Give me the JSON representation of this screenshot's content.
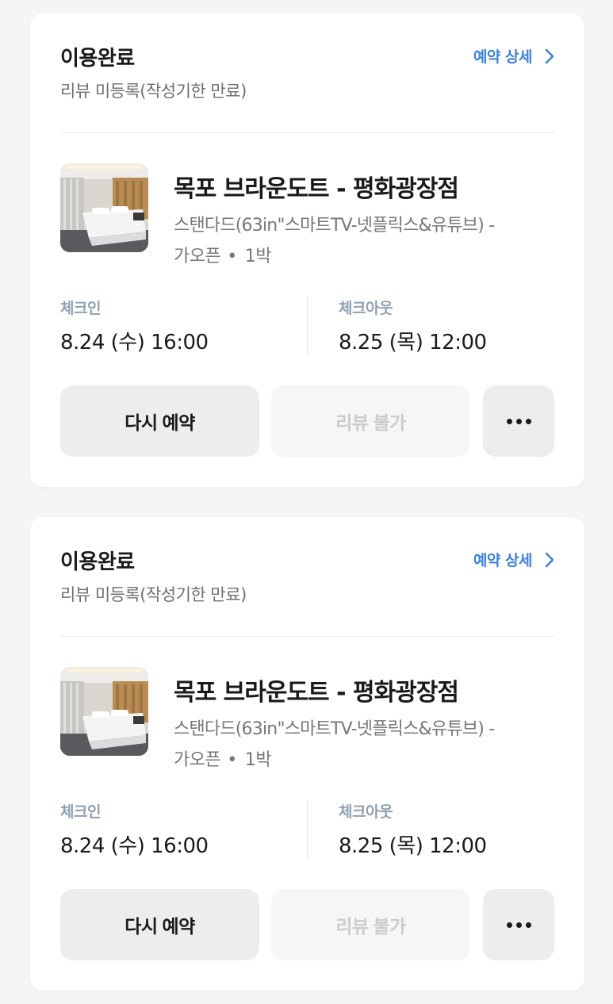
{
  "reservations": [
    {
      "status": "이용완료",
      "review_status": "리뷰 미등록(작성기한 만료)",
      "detail_label": "예약 상세",
      "hotel_name": "목포 브라운도트 - 평화광장점",
      "room_line1": "스탠다드(63in\"스마트TV-넷플릭스&유튜브) -",
      "room_line2": "가오픈",
      "nights": "1박",
      "checkin_label": "체크인",
      "checkin_value": "8.24 (수) 16:00",
      "checkout_label": "체크아웃",
      "checkout_value": "8.25 (목) 12:00",
      "rebook_label": "다시 예약",
      "review_label": "리뷰 불가"
    },
    {
      "status": "이용완료",
      "review_status": "리뷰 미등록(작성기한 만료)",
      "detail_label": "예약 상세",
      "hotel_name": "목포 브라운도트 - 평화광장점",
      "room_line1": "스탠다드(63in\"스마트TV-넷플릭스&유튜브) -",
      "room_line2": "가오픈",
      "nights": "1박",
      "checkin_label": "체크인",
      "checkin_value": "8.24 (수) 16:00",
      "checkout_label": "체크아웃",
      "checkout_value": "8.25 (목) 12:00",
      "rebook_label": "다시 예약",
      "review_label": "리뷰 불가"
    }
  ],
  "icons": {
    "detail_chevron": "chevron-right-icon",
    "more": "more-dots-icon",
    "thumbnail": "hotel-room-photo"
  },
  "colors": {
    "accent": "#3b82d6",
    "label_muted": "#8fa0b3",
    "background": "#f5f5f5",
    "button_bg": "#ededed",
    "button_disabled_text": "#cccccc"
  }
}
